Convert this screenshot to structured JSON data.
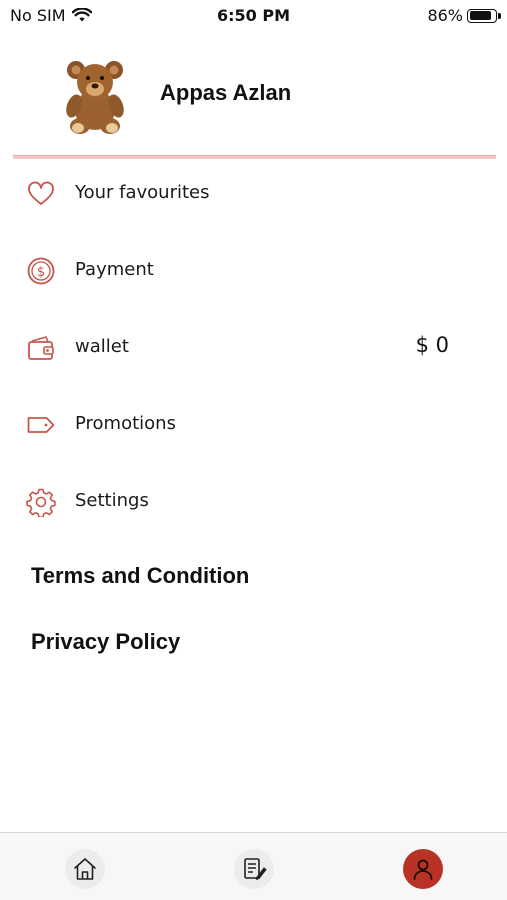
{
  "status_bar": {
    "carrier": "No SIM",
    "time": "6:50 PM",
    "battery_percent": "86%",
    "battery_level": 0.86
  },
  "profile": {
    "name": "Appas Azlan",
    "avatar_icon": "teddy-bear-avatar"
  },
  "menu": {
    "favourites": {
      "label": "Your favourites",
      "icon": "heart-icon"
    },
    "payment": {
      "label": "Payment",
      "icon": "dollar-coin-icon"
    },
    "wallet": {
      "label": "wallet",
      "icon": "wallet-icon",
      "value": "$ 0"
    },
    "promotions": {
      "label": "Promotions",
      "icon": "tag-icon"
    },
    "settings": {
      "label": "Settings",
      "icon": "gear-icon"
    }
  },
  "links": {
    "terms": "Terms and Condition",
    "privacy": "Privacy Policy"
  },
  "tabbar": {
    "tabs": [
      {
        "icon": "home-icon",
        "active": false
      },
      {
        "icon": "document-edit-icon",
        "active": false
      },
      {
        "icon": "user-icon",
        "active": true
      }
    ]
  },
  "colors": {
    "accent": "#b83325",
    "icon_stroke": "#c9544a",
    "divider": "#f2c7c4"
  }
}
